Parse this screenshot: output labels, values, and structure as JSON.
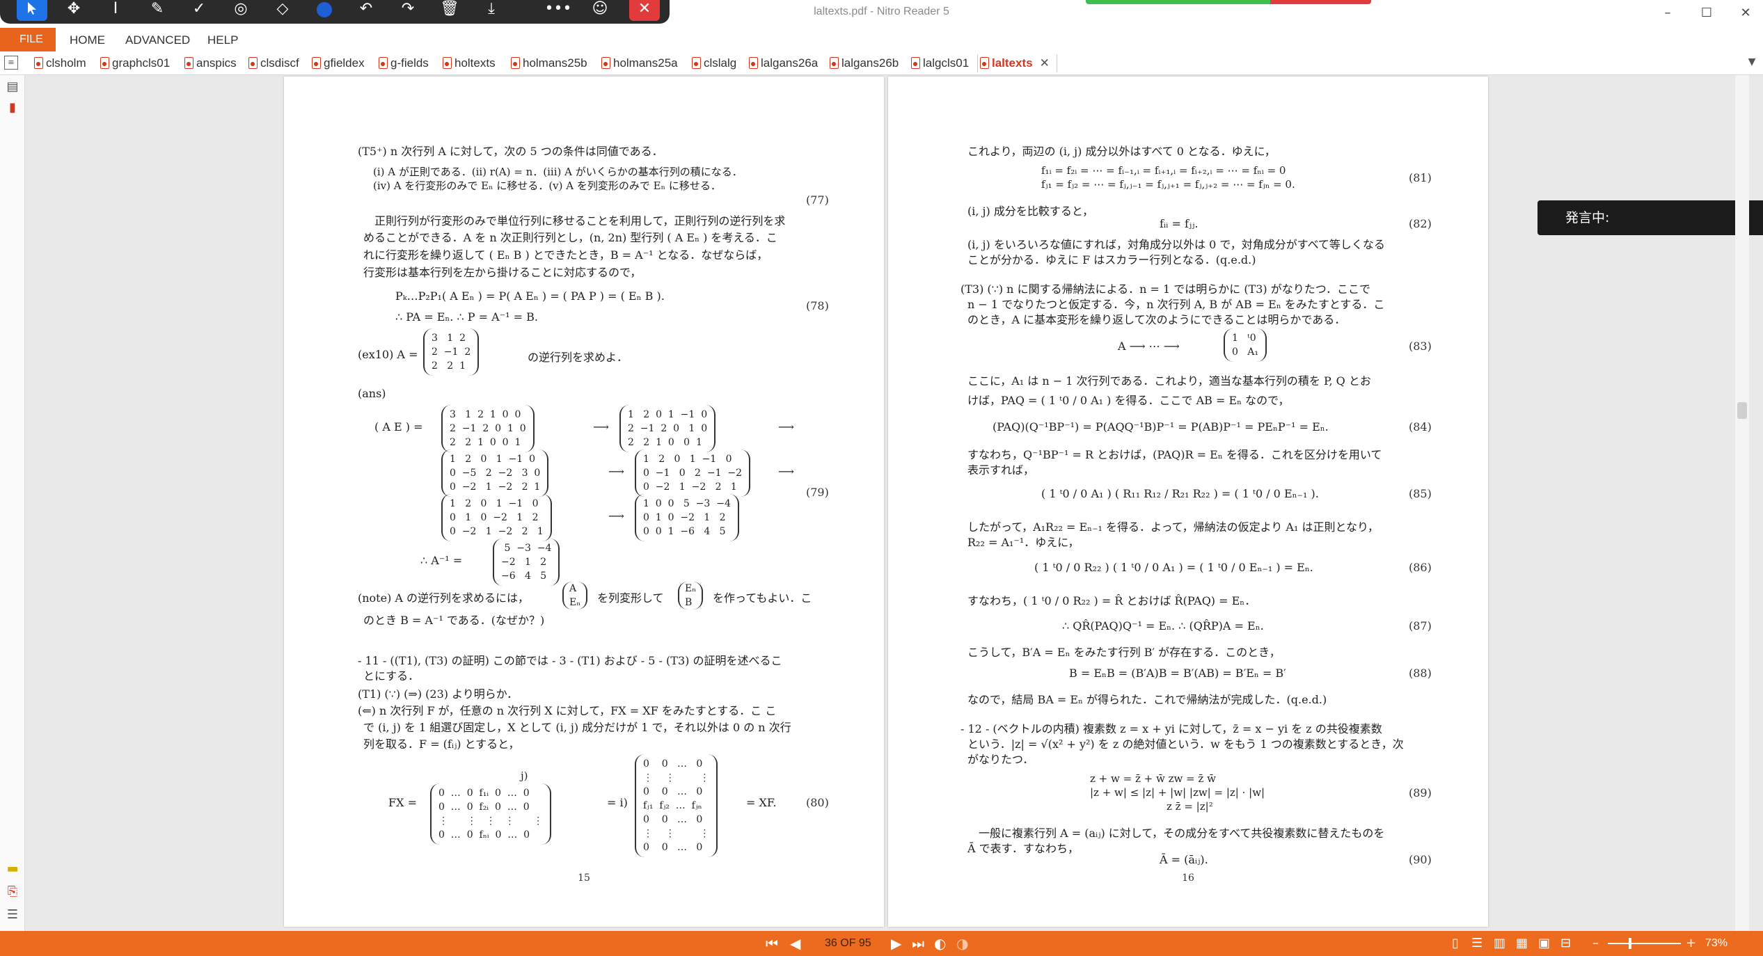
{
  "window": {
    "title": "laltexts.pdf - Nitro Reader 5",
    "minimize": "–",
    "maximize": "☐",
    "close": "✕"
  },
  "toolbar": {
    "tools": [
      "select-icon",
      "pan-icon",
      "text-cursor-icon",
      "pen-icon",
      "check-icon",
      "stamp-icon",
      "eraser-icon",
      "color-icon",
      "undo-icon",
      "redo-icon",
      "delete-icon",
      "download-icon",
      "more-icon",
      "user-icon",
      "close-icon"
    ],
    "select_color": "#1e73e8",
    "close_color": "#e23b3b"
  },
  "menu": {
    "file": "FILE",
    "items": [
      "HOME",
      "ADVANCED",
      "HELP"
    ],
    "accent": "#e8641d"
  },
  "tabs": [
    {
      "label": "clsholm"
    },
    {
      "label": "graphcls01"
    },
    {
      "label": "anspics"
    },
    {
      "label": "clsdiscf"
    },
    {
      "label": "gfieldex"
    },
    {
      "label": "g-fields"
    },
    {
      "label": "holtexts"
    },
    {
      "label": "holmans25b"
    },
    {
      "label": "holmans25a"
    },
    {
      "label": "clslalg"
    },
    {
      "label": "lalgans26a"
    },
    {
      "label": "lalgans26b"
    },
    {
      "label": "lalgcls01"
    },
    {
      "label": "laltexts",
      "active": true
    }
  ],
  "popup": {
    "text": "発言中:"
  },
  "status": {
    "page_indicator": "36 OF 95",
    "zoom": "73%",
    "zoom_minus": "–",
    "zoom_plus": "+"
  },
  "left_page": {
    "number": "15",
    "l1": "(T5⁺) n 次行列 A に対して，次の 5 つの条件は同値である．",
    "l2": "(i) A が正則である．(ii) r(A) = n．(iii) A がいくらかの基本行列の積になる．",
    "l3": "(iv) A を行変形のみで Eₙ に移せる．(v) A を列変形のみで Eₙ に移せる．",
    "eq77": "(77)",
    "p1": "正則行列が行変形のみで単位行列に移せることを利用して，正則行列の逆行列を求",
    "p2": "めることができる．A を n 次正則行列とし，(n, 2n) 型行列 ( A  Eₙ ) を考える．こ",
    "p3": "れに行変形を繰り返して ( Eₙ  B ) とできたとき，B = A⁻¹ となる．なぜならば，",
    "p4": "行変形は基本行列を左から掛けることに対応するので，",
    "eq78a": "Pₖ…P₂P₁( A  Eₙ ) = P( A  Eₙ ) = ( PA  P ) = ( Eₙ  B ).",
    "eq78b": "∴ PA = Eₙ.     ∴ P = A⁻¹ = B.",
    "eq78": "(78)",
    "ex10": "(ex10) A =",
    "ex10_matrix": "3   1  2\n2  −1  2\n2   2  1",
    "ex10_tail": "の逆行列を求めよ．",
    "ans": "(ans)",
    "ae": "( A  E ) =",
    "m1": "3   1  2  1  0  0\n2  −1  2  0  1  0\n2   2  1  0  0  1",
    "m2": "1   2  0  1  −1  0\n2  −1  2  0   1  0\n2   2  1  0   0  1",
    "m3": "1   2   0   1  −1  0\n0  −5   2  −2   3  0\n0  −2   1  −2   2  1",
    "m4": "1   2   0   1  −1   0\n0  −1   0   2  −1  −2\n0  −2   1  −2   2   1",
    "m5": "1   2   0   1  −1   0\n0   1   0  −2   1   2\n0  −2   1  −2   2   1",
    "m6": "1  0  0   5  −3  −4\n0  1  0  −2   1   2\n0  0  1  −6   4   5",
    "inv_lhs": "∴    A⁻¹ =",
    "inv": " 5  −3  −4\n−2   1   2\n−6   4   5",
    "eq79": "(79)",
    "note1": "(note) A の逆行列を求めるには，",
    "note1b": "を列変形して",
    "note1c": "を作ってもよい．こ",
    "note2": "のとき B = A⁻¹ である．(なぜか？)",
    "sec11a": "- 11 - ((T1), (T3) の証明) この節では - 3 - (T1) および - 5 - (T3) の証明を述べるこ",
    "sec11b": "とにする．",
    "t1": "(T1) (∵) (⇒) (23) より明らか．",
    "t1b": "(⇐) n 次行列 F が，任意の n 次行列 X に対して，FX = XF をみたすとする．こ こ",
    "t1c": "で (i, j) を 1 組選び固定し，X として (i, j) 成分だけが 1 で，それ以外は 0 の n 次行",
    "t1d": "列を取る．F = (fᵢⱼ) とすると，",
    "fx": "FX =",
    "fx_j": "j)",
    "fxm1": "0  …  0  f₁ᵢ  0  …  0\n0  …  0  f₂ᵢ  0  …  0\n⋮      ⋮   ⋮   ⋮      ⋮\n0  …  0  fₙᵢ  0  …  0",
    "fx_eq": "=  i)",
    "fxm2": "0    0   …   0\n⋮    ⋮        ⋮\n0    0   …   0\nfⱼ₁  fⱼ₂  …  fⱼₙ\n0    0   …   0\n⋮    ⋮        ⋮\n0    0   …   0",
    "fx_tail": "= XF.",
    "eq80": "(80)"
  },
  "right_page": {
    "number": "16",
    "r1": "これより，両辺の (i, j) 成分以外はすべて 0 となる．ゆえに，",
    "eq81a": "f₁ᵢ = f₂ᵢ = ⋯ = fᵢ₋₁,ᵢ = fᵢ₊₁,ᵢ = fᵢ₊₂,ᵢ = ⋯ = fₙᵢ = 0",
    "eq81b": "fⱼ₁ = fⱼ₂ = ⋯ = fⱼ,ⱼ₋₁ = fⱼ,ⱼ₊₁ = fⱼ,ⱼ₊₂ = ⋯ = fⱼₙ = 0.",
    "eq81": "(81)",
    "r2": "(i, j) 成分を比較すると，",
    "eq82a": "fᵢᵢ = fⱼⱼ.",
    "eq82": "(82)",
    "r3": "(i, j) をいろいろな値にすれば，対角成分以外は 0 で，対角成分がすべて等しくなる",
    "r4": "ことが分かる．ゆえに F はスカラー行列となる．(q.e.d.)",
    "t3a": "(T3) (∵) n に関する帰納法による．n = 1 では明らかに (T3) がなりたつ．ここで",
    "t3b": "n − 1 でなりたつと仮定する．今，n 次行列 A, B が AB = Eₙ をみたすとする．こ",
    "t3c": "のとき，A に基本変形を繰り返して次のようにできることは明らかである．",
    "eq83a": "A ⟶ ⋯ ⟶",
    "eq83m": "1   ᵗ0\n0   A₁",
    "eq83": "(83)",
    "r5": "ここに，A₁ は n − 1 次行列である．これより，適当な基本行列の積を P, Q とお",
    "r6": "けば，PAQ = ( 1 ᵗ0 / 0 A₁ ) を得る．ここで AB = Eₙ なので，",
    "eq84a": "(PAQ)(Q⁻¹BP⁻¹) = P(AQQ⁻¹B)P⁻¹ = P(AB)P⁻¹ = PEₙP⁻¹ = Eₙ.",
    "eq84": "(84)",
    "r7": "すなわち，Q⁻¹BP⁻¹ = R とおけば，(PAQ)R = Eₙ を得る．これを区分けを用いて",
    "r8": "表示すれば，",
    "eq85a": "( 1  ᵗ0 / 0  A₁ ) ( R₁₁  R₁₂ / R₂₁  R₂₂ ) = ( 1  ᵗ0 / 0  Eₙ₋₁ ).",
    "eq85": "(85)",
    "r9": "したがって，A₁R₂₂ = Eₙ₋₁ を得る．よって，帰納法の仮定より A₁ は正則となり，",
    "r10": "R₂₂ = A₁⁻¹．ゆえに，",
    "eq86a": "( 1  ᵗ0 / 0  R₂₂ ) ( 1  ᵗ0 / 0  A₁ ) = ( 1  ᵗ0 / 0  Eₙ₋₁ ) = Eₙ.",
    "eq86": "(86)",
    "r11": "すなわち，( 1  ᵗ0 / 0  R₂₂ ) = R̂ とおけば R̂(PAQ) = Eₙ．",
    "eq87a": "∴ QR̂(PAQ)Q⁻¹ = Eₙ.     ∴ (QR̂P)A = Eₙ.",
    "eq87": "(87)",
    "r12": "こうして，B′A = Eₙ をみたす行列 B′ が存在する．このとき，",
    "eq88a": "B = EₙB = (B′A)B = B′(AB) = B′Eₙ = B′",
    "eq88": "(88)",
    "r13": "なので，結局 BA = Eₙ が得られた．これで帰納法が完成した．(q.e.d.)",
    "s12a": "- 12 - (ベクトルの内積) 複素数 z = x + yi に対して，z̄ = x − yi を z の共役複素数",
    "s12b": "という．|z| = √(x² + y²) を z の絶対値という．w をもう 1 つの複素数とするとき，次",
    "s12c": "がなりたつ．",
    "eq89a": "z + w = z̄ + w̄          zw = z̄ w̄",
    "eq89b": "|z + w| ≤ |z| + |w|     |zw| = |z| · |w|",
    "eq89c": "z z̄ = |z|²",
    "eq89": "(89)",
    "s12d": "一般に複素行列 A = (aᵢⱼ) に対して，その成分をすべて共役複素数に替えたものを",
    "s12e": "Ā で表す．すなわち，",
    "eq90a": "Ā = (āᵢⱼ).",
    "eq90": "(90)"
  }
}
